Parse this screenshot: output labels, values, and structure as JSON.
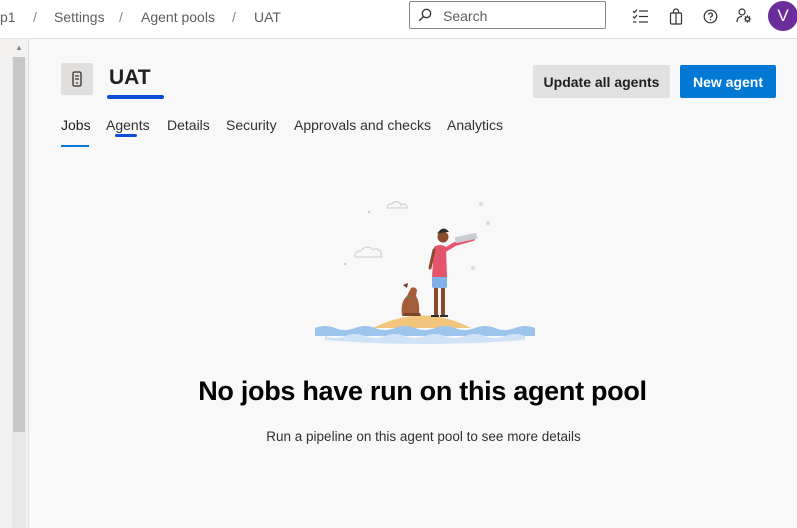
{
  "breadcrumb": {
    "items": [
      "p1",
      "Settings",
      "Agent pools",
      "UAT"
    ],
    "separator": "/"
  },
  "search": {
    "placeholder": "Search",
    "value": ""
  },
  "top_icons": [
    "checklist-icon",
    "shopping-bag-icon",
    "help-icon",
    "user-settings-icon"
  ],
  "user": {
    "avatar_initial": "V",
    "avatar_color": "#6b2d9b"
  },
  "header": {
    "title": "UAT",
    "update_button_label": "Update all agents",
    "new_agent_button_label": "New agent"
  },
  "tabs": [
    {
      "label": "Jobs",
      "selected": true
    },
    {
      "label": "Agents",
      "selected": false
    },
    {
      "label": "Details",
      "selected": false
    },
    {
      "label": "Security",
      "selected": false
    },
    {
      "label": "Approvals and checks",
      "selected": false
    },
    {
      "label": "Analytics",
      "selected": false
    }
  ],
  "empty_state": {
    "title": "No jobs have run on this agent pool",
    "subtitle": "Run a pipeline on this agent pool to see more details"
  },
  "colors": {
    "accent": "#0078d4",
    "annotation_blue": "#0a4fd8"
  }
}
